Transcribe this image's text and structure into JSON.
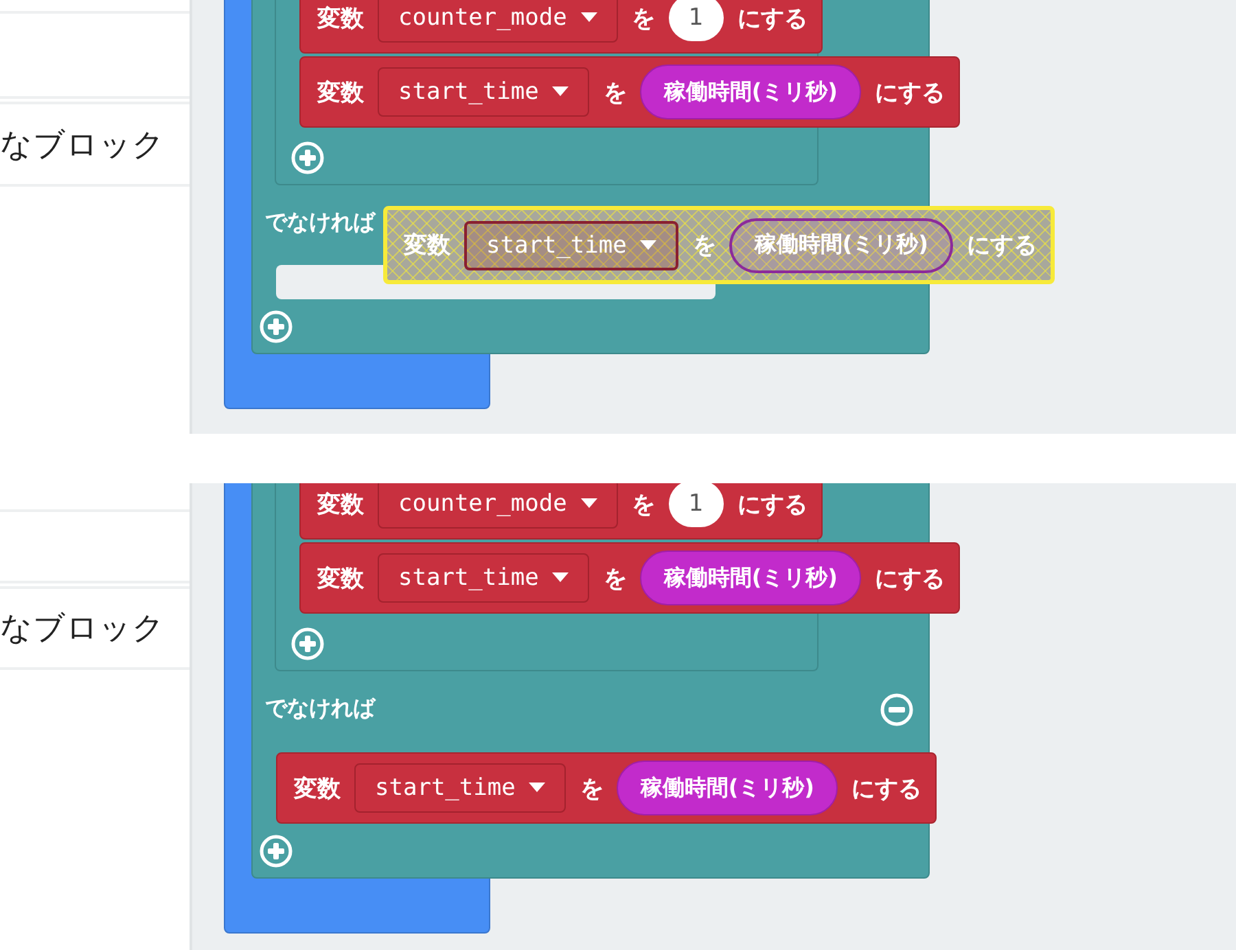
{
  "panels": [
    {
      "sidebar": {
        "label": "なブロック"
      },
      "if_block": {
        "then_blocks": [
          {
            "label": "変数",
            "variable": "counter_mode",
            "connector": "を",
            "value": {
              "kind": "number",
              "text": "1"
            },
            "suffix": "にする"
          },
          {
            "label": "変数",
            "variable": "start_time",
            "connector": "を",
            "value": {
              "kind": "reporter",
              "text": "稼働時間(ミリ秒)"
            },
            "suffix": "にする"
          }
        ],
        "else_label": "でなければ"
      },
      "floating_block": {
        "label": "変数",
        "variable": "start_time",
        "connector": "を",
        "value": {
          "kind": "reporter",
          "text": "稼働時間(ミリ秒)"
        },
        "suffix": "にする",
        "dragging": true
      }
    },
    {
      "sidebar": {
        "label": "なブロック"
      },
      "if_block": {
        "then_blocks": [
          {
            "label": "変数",
            "variable": "counter_mode",
            "connector": "を",
            "value": {
              "kind": "number",
              "text": "1"
            },
            "suffix": "にする"
          },
          {
            "label": "変数",
            "variable": "start_time",
            "connector": "を",
            "value": {
              "kind": "reporter",
              "text": "稼働時間(ミリ秒)"
            },
            "suffix": "にする"
          }
        ],
        "else_label": "でなければ",
        "else_blocks": [
          {
            "label": "変数",
            "variable": "start_time",
            "connector": "を",
            "value": {
              "kind": "reporter",
              "text": "稼働時間(ミリ秒)"
            },
            "suffix": "にする"
          }
        ]
      }
    }
  ]
}
